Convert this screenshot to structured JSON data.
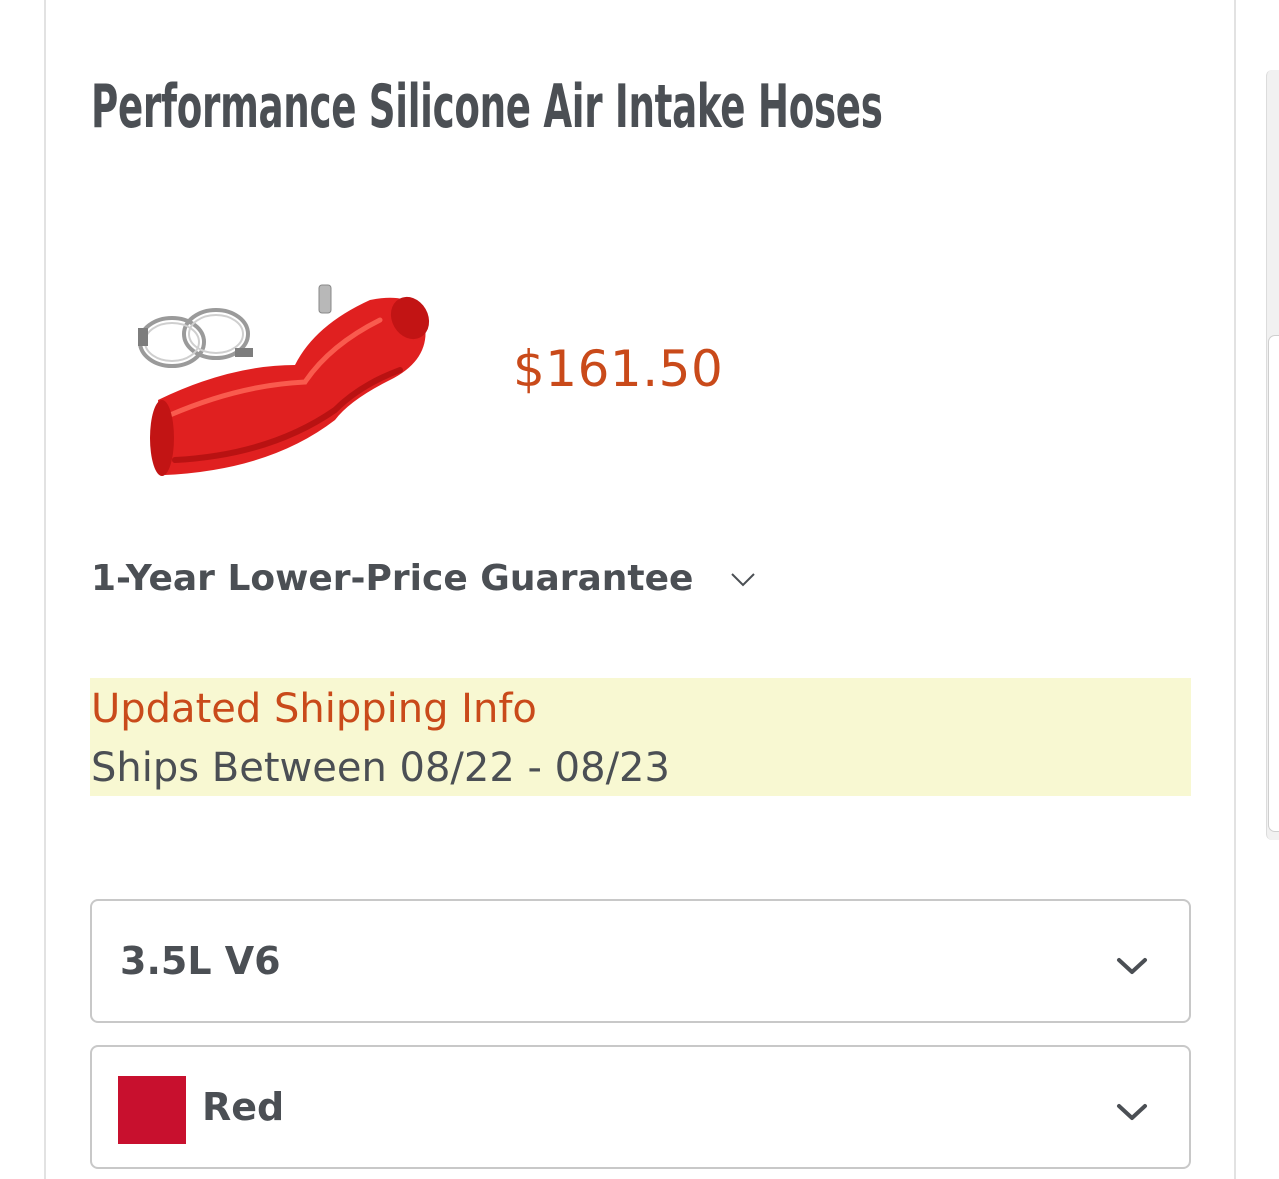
{
  "product": {
    "title": "Performance Silicone Air Intake Hoses",
    "price": "$161.50",
    "image_alt": "Red silicone air intake hose with two hose clamps"
  },
  "guarantee": {
    "label": "1-Year Lower-Price Guarantee",
    "icon": "chevron-down-icon"
  },
  "shipping": {
    "title": "Updated Shipping Info",
    "dates": "Ships Between 08/22 - 08/23"
  },
  "options": {
    "engine": {
      "value": "3.5L V6",
      "icon": "chevron-down-icon"
    },
    "color": {
      "value": "Red",
      "swatch_color": "#c8102e",
      "icon": "chevron-down-icon"
    }
  },
  "colors": {
    "accent": "#c94a1a",
    "text": "#4b4f54",
    "notice_bg": "#f8f8d2"
  }
}
